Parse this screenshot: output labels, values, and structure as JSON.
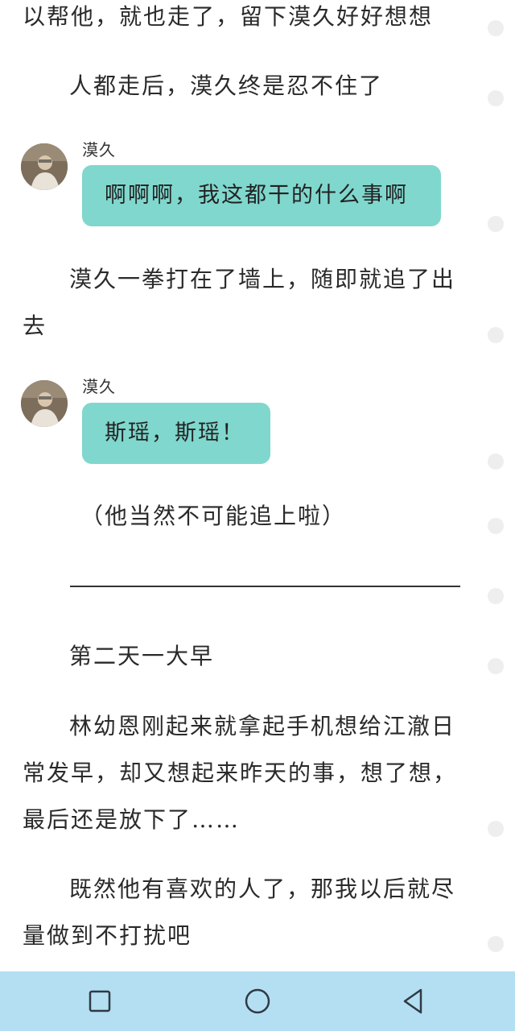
{
  "story": {
    "p1": "以帮他，就也走了，留下漠久好好想想",
    "p2": "人都走后，漠久终是忍不住了",
    "p3": "漠久一拳打在了墙上，随即就追了出\n去",
    "p4": "（他当然不可能追上啦）",
    "p5": "第二天一大早",
    "p6": "林幼恩刚起来就拿起手机想给江澈日\n常发早，却又想起来昨天的事，想了想，\n最后还是放下了……",
    "p7": "既然他有喜欢的人了，那我以后就尽\n量做到不打扰吧"
  },
  "chat": [
    {
      "speaker": "漠久",
      "text": "啊啊啊，我这都干的什么事啊"
    },
    {
      "speaker": "漠久",
      "text": "斯瑶，斯瑶！"
    }
  ],
  "navbar": {
    "recents_icon": "square-icon",
    "home_icon": "circle-icon",
    "back_icon": "triangle-back-icon",
    "background_color": "#b4dff2"
  },
  "colors": {
    "bubble": "#80d7cd",
    "text": "#2a2a2a"
  }
}
